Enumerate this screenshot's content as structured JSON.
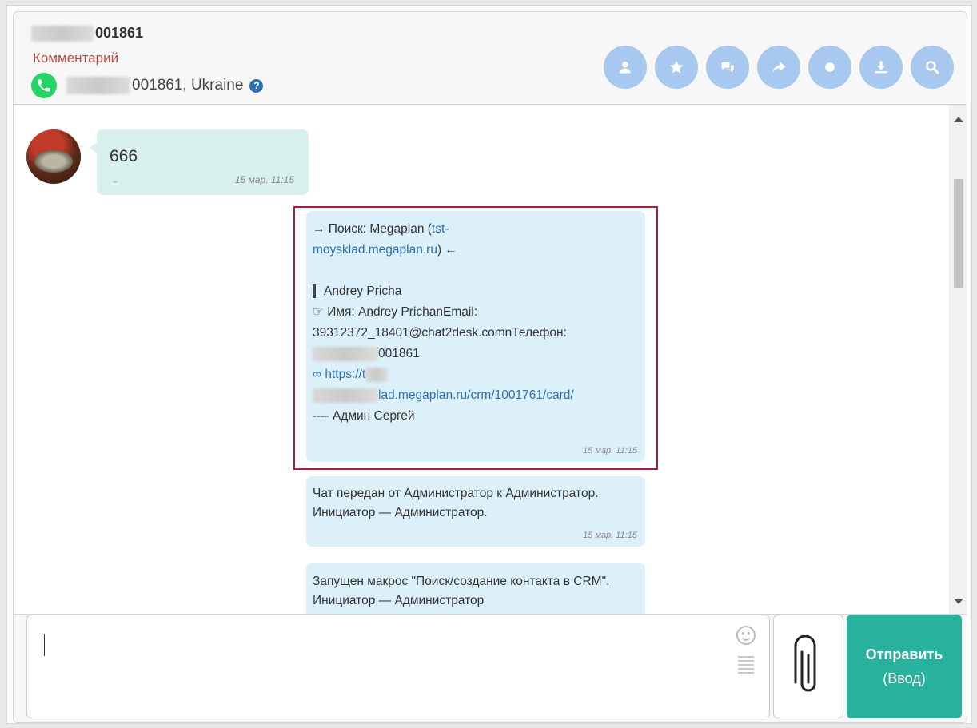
{
  "header": {
    "contact_name_suffix": "001861",
    "comment_link": "Комментарий",
    "phone_suffix": "001861, Ukraine",
    "help_symbol": "?",
    "actions": [
      {
        "icon": "user-icon"
      },
      {
        "icon": "star-icon"
      },
      {
        "icon": "chat-icon"
      },
      {
        "icon": "share-icon"
      },
      {
        "icon": "circle-icon"
      },
      {
        "icon": "download-icon"
      },
      {
        "icon": "search-icon"
      }
    ]
  },
  "messages": {
    "incoming": {
      "text": "666",
      "time": "15 мар. 11:15"
    },
    "search_result": {
      "line1_prefix": "→ Поиск: Megaplan (",
      "line1_link": "tst-",
      "line2_link": "moysklad.megaplan.ru",
      "line2_suffix": ") ←",
      "name_line": "Andrey Pricha",
      "name_detail": "☞ Имя: Andrey PrichanEmail:",
      "email_phone": "39312372_18401@chat2desk.comnТелефон:",
      "phone_suffix": "001861",
      "url_prefix": "∞ https://t",
      "url_rest": "lad.megaplan.ru/crm/1001761/card/",
      "signature": "---- Админ Сергей",
      "time": "15 мар. 11:15"
    },
    "transfer": {
      "text": "Чат передан от Администратор к Администратор. Инициатор — Администратор.",
      "time": "15 мар. 11:15"
    },
    "macro": {
      "text": "Запущен макрос \"Поиск/создание контакта в CRM\". Инициатор — Администратор"
    }
  },
  "composer": {
    "input_value": "",
    "send_label": "Отправить",
    "send_hint": "(Ввод)"
  },
  "colors": {
    "accent": "#28b19d",
    "action_button": "#a9c8ef",
    "highlight_border": "#a0223a",
    "comment": "#b94a48"
  }
}
